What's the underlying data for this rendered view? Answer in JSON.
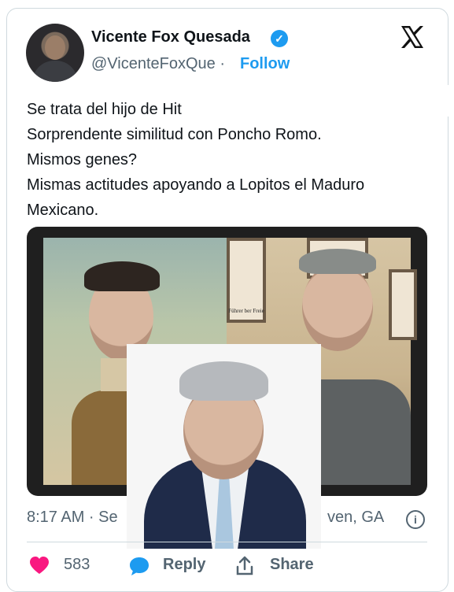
{
  "header": {
    "name": "Vicente Fox Quesada",
    "handle": "@VicenteFoxQue",
    "separator": "·",
    "follow_label": "Follow",
    "verified_icon": "check-badge-icon",
    "x_logo_icon": "x-logo-icon"
  },
  "tweet": {
    "lines": [
      "Se trata del hijo de Hit",
      "Sorprendente similitud con Poncho Romo.",
      "Mismos genes?",
      "Mismas actitudes apoyando a Lopitos el Maduro",
      "Mexicano."
    ]
  },
  "media": {
    "poster_caption": "Führer ber Freie"
  },
  "meta": {
    "time": "8:17 AM · Se",
    "location": "ven, GA",
    "info_icon": "info-icon"
  },
  "actions": {
    "likes": "583",
    "reply_label": "Reply",
    "share_label": "Share",
    "like_icon": "heart-icon",
    "reply_icon": "reply-icon",
    "share_icon": "share-icon"
  },
  "colors": {
    "accent": "#1d9bf0",
    "like": "#f91880",
    "muted": "#536471",
    "border": "#cfd9de"
  }
}
